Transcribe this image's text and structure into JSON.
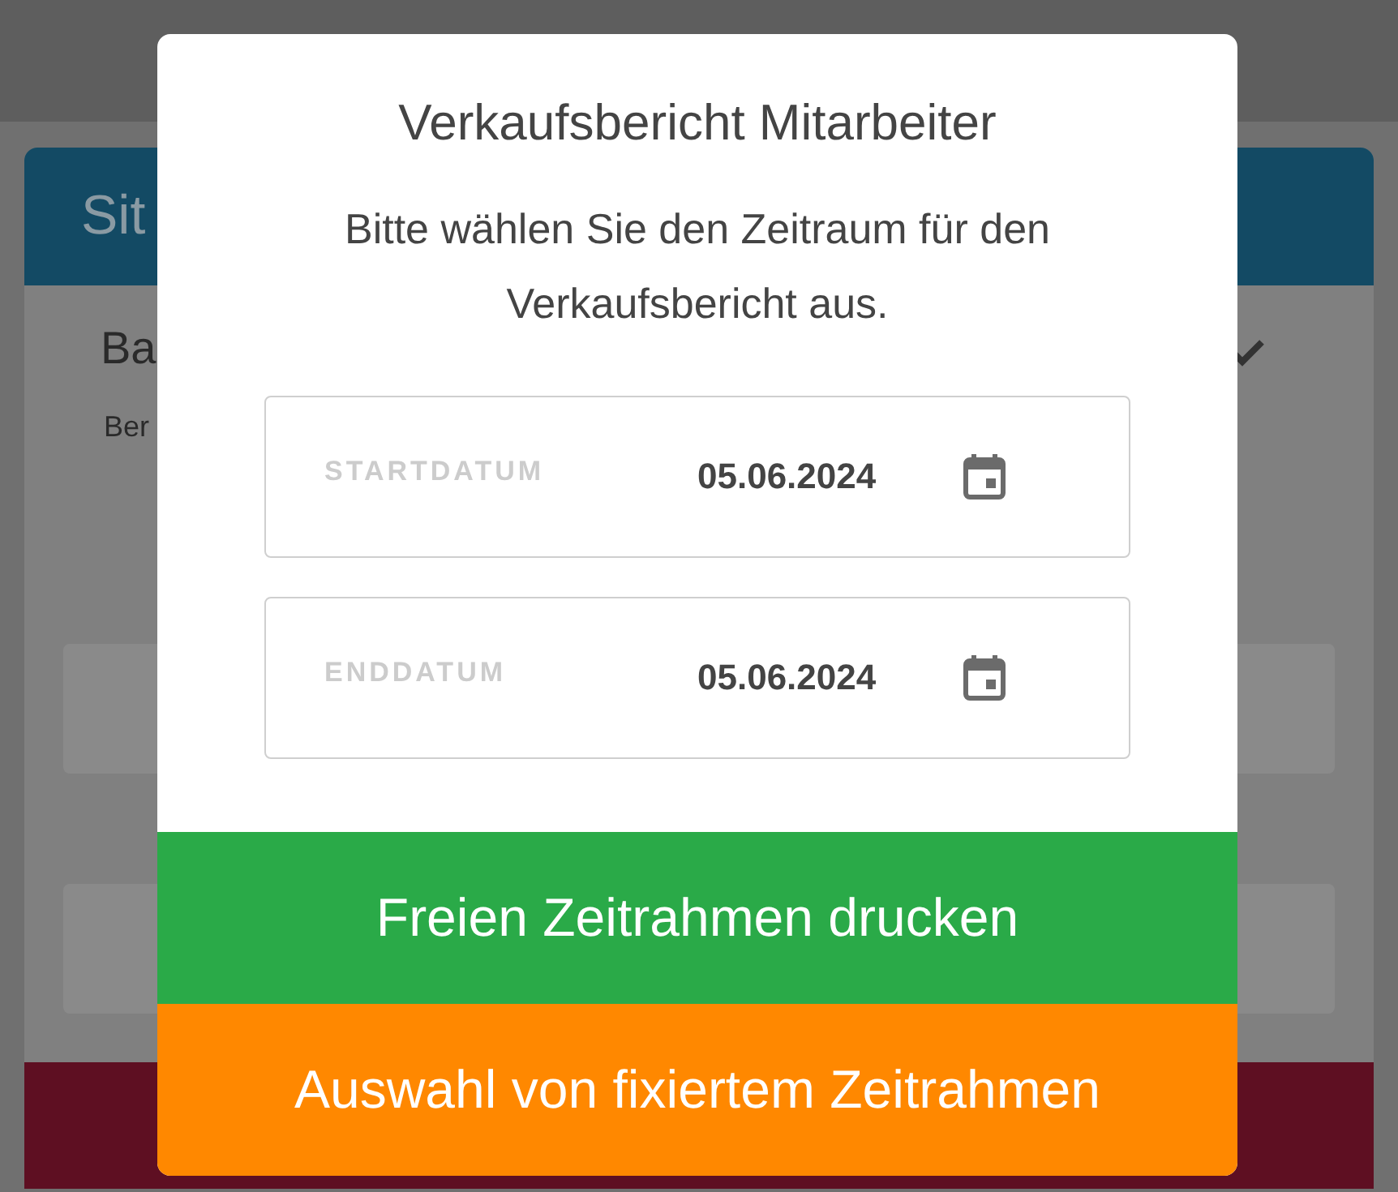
{
  "background": {
    "card_title": "Sit",
    "item_title": "Ba",
    "item_subtitle": "Ber",
    "item_checked": true
  },
  "dialog": {
    "title": "Verkaufsbericht Mitarbeiter",
    "message": "Bitte wählen Sie den Zeitraum für den Verkaufsbericht aus.",
    "fields": [
      {
        "label": "STARTDATUM",
        "value": "05.06.2024"
      },
      {
        "label": "ENDDATUM",
        "value": "05.06.2024"
      }
    ],
    "buttons": [
      {
        "kind": "primary",
        "label": "Freien Zeitrahmen drucken"
      },
      {
        "kind": "secondary",
        "label": "Auswahl von fixiertem Zeitrahmen"
      }
    ]
  }
}
